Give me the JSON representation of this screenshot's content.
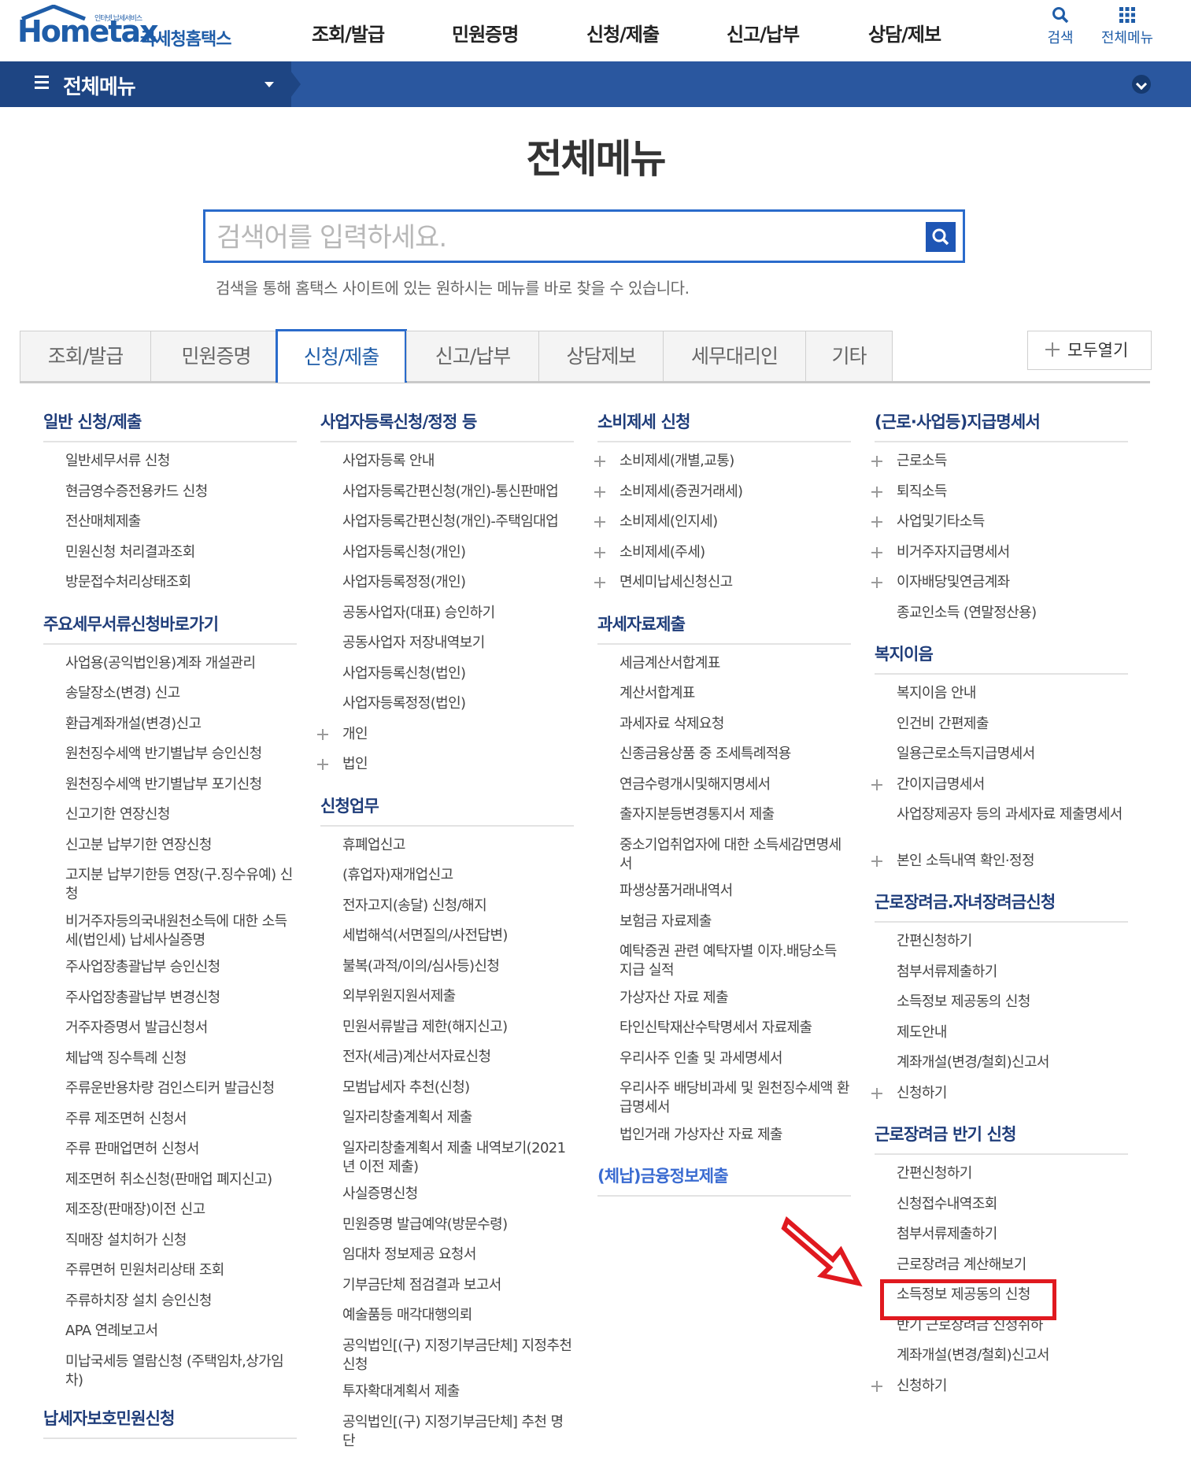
{
  "header": {
    "logo_small": "인터넷 납세서비스",
    "logo_main": "Hometax",
    "logo_sub": "국세청홈택스",
    "nav": [
      "조회/발급",
      "민원증명",
      "신청/제출",
      "신고/납부",
      "상담/제보"
    ],
    "search_label": "검색",
    "menu_label": "전체메뉴"
  },
  "bar": {
    "title": "전체메뉴"
  },
  "page": {
    "title": "전체메뉴",
    "search_placeholder": "검색어를 입력하세요.",
    "search_hint": "검색을 통해 홈택스 사이트에 있는 원하시는 메뉴를 바로 찾을 수 있습니다."
  },
  "tabs": [
    {
      "label": "조회/발급",
      "active": false
    },
    {
      "label": "민원증명",
      "active": false
    },
    {
      "label": "신청/제출",
      "active": true
    },
    {
      "label": "신고/납부",
      "active": false
    },
    {
      "label": "상담제보",
      "active": false
    },
    {
      "label": "세무대리인",
      "active": false
    },
    {
      "label": "기타",
      "active": false
    }
  ],
  "open_all_label": "모두열기",
  "columns": [
    {
      "sections": [
        {
          "title": "일반 신청/제출",
          "items": [
            {
              "text": "일반세무서류 신청"
            },
            {
              "text": "현금영수증전용카드 신청"
            },
            {
              "text": "전산매체제출"
            },
            {
              "text": "민원신청 처리결과조회"
            },
            {
              "text": "방문접수처리상태조회"
            }
          ]
        },
        {
          "title": "주요세무서류신청바로가기",
          "items": [
            {
              "text": "사업용(공익법인용)계좌 개설관리"
            },
            {
              "text": "송달장소(변경) 신고"
            },
            {
              "text": "환급계좌개설(변경)신고"
            },
            {
              "text": "원천징수세액 반기별납부 승인신청"
            },
            {
              "text": "원천징수세액 반기별납부 포기신청"
            },
            {
              "text": "신고기한 연장신청"
            },
            {
              "text": "신고분 납부기한 연장신청"
            },
            {
              "text": "고지분 납부기한등 연장(구.징수유예) 신청"
            },
            {
              "text": "비거주자등의국내원천소득에 대한 소득세(법인세) 납세사실증명"
            },
            {
              "text": "주사업장총괄납부 승인신청"
            },
            {
              "text": "주사업장총괄납부 변경신청"
            },
            {
              "text": "거주자증명서 발급신청서"
            },
            {
              "text": "체납액 징수특례 신청"
            },
            {
              "text": "주류운반용차량 검인스티커 발급신청"
            },
            {
              "text": "주류 제조면허 신청서"
            },
            {
              "text": "주류 판매업면허 신청서"
            },
            {
              "text": "제조면허 취소신청(판매업 폐지신고)"
            },
            {
              "text": "제조장(판매장)이전 신고"
            },
            {
              "text": "직매장 설치허가 신청"
            },
            {
              "text": "주류면허 민원처리상태 조회"
            },
            {
              "text": "주류하치장 설치 승인신청"
            },
            {
              "text": "APA 연례보고서"
            },
            {
              "text": "미납국세등 열람신청 (주택임차,상가임차)"
            }
          ]
        },
        {
          "title": "납세자보호민원신청",
          "items": []
        }
      ]
    },
    {
      "sections": [
        {
          "title": "사업자등록신청/정정 등",
          "items": [
            {
              "text": "사업자등록 안내"
            },
            {
              "text": "사업자등록간편신청(개인)-통신판매업"
            },
            {
              "text": "사업자등록간편신청(개인)-주택임대업"
            },
            {
              "text": "사업자등록신청(개인)"
            },
            {
              "text": "사업자등록정정(개인)"
            },
            {
              "text": "공동사업자(대표) 승인하기"
            },
            {
              "text": "공동사업자 저장내역보기"
            },
            {
              "text": "사업자등록신청(법인)"
            },
            {
              "text": "사업자등록정정(법인)"
            },
            {
              "text": "개인",
              "plus": true
            },
            {
              "text": "법인",
              "plus": true
            }
          ]
        },
        {
          "title": "신청업무",
          "items": [
            {
              "text": "휴폐업신고"
            },
            {
              "text": "(휴업자)재개업신고"
            },
            {
              "text": "전자고지(송달) 신청/해지"
            },
            {
              "text": "세법해석(서면질의/사전답변)"
            },
            {
              "text": "불복(과적/이의/심사등)신청"
            },
            {
              "text": "외부위원지원서제출"
            },
            {
              "text": "민원서류발급 제한(해지신고)"
            },
            {
              "text": "전자(세금)계산서자료신청"
            },
            {
              "text": "모범납세자 추천(신청)"
            },
            {
              "text": "일자리창출계획서 제출"
            },
            {
              "text": "일자리창출계획서 제출 내역보기(2021년 이전 제출)"
            },
            {
              "text": "사실증명신청"
            },
            {
              "text": "민원증명 발급예약(방문수령)"
            },
            {
              "text": "임대차 정보제공 요청서"
            },
            {
              "text": "기부금단체 점검결과 보고서"
            },
            {
              "text": "예술품등 매각대행의뢰"
            },
            {
              "text": "공익법인[(구) 지정기부금단체] 지정추천 신청"
            },
            {
              "text": "투자확대계획서 제출"
            },
            {
              "text": "공익법인[(구) 지정기부금단체] 추천 명단"
            }
          ]
        }
      ]
    },
    {
      "sections": [
        {
          "title": "소비제세 신청",
          "items": [
            {
              "text": "소비제세(개별,교통)",
              "plus": true
            },
            {
              "text": "소비제세(증권거래세)",
              "plus": true
            },
            {
              "text": "소비제세(인지세)",
              "plus": true
            },
            {
              "text": "소비제세(주세)",
              "plus": true
            },
            {
              "text": "면세미납세신청신고",
              "plus": true
            }
          ]
        },
        {
          "title": "과세자료제출",
          "items": [
            {
              "text": "세금계산서합계표"
            },
            {
              "text": "계산서합계표"
            },
            {
              "text": "과세자료 삭제요청"
            },
            {
              "text": "신종금융상품 중 조세특례적용"
            },
            {
              "text": "연금수령개시및해지명세서"
            },
            {
              "text": "출자지분등변경통지서 제출"
            },
            {
              "text": "중소기업취업자에 대한 소득세감면명세서"
            },
            {
              "text": "파생상품거래내역서"
            },
            {
              "text": "보험금 자료제출"
            },
            {
              "text": "예탁증권 관련 예탁자별 이자.배당소득 지급 실적"
            },
            {
              "text": "가상자산 자료 제출"
            },
            {
              "text": "타인신탁재산수탁명세서 자료제출"
            },
            {
              "text": "우리사주 인출 및 과세명세서"
            },
            {
              "text": "우리사주 배당비과세 및 원천징수세액 환급명세서"
            },
            {
              "text": "법인거래 가상자산 자료 제출"
            }
          ]
        },
        {
          "title": "(체납)금융정보제출",
          "items": [],
          "blue": true
        }
      ]
    },
    {
      "sections": [
        {
          "title": "(근로·사업등)지급명세서",
          "items": [
            {
              "text": "근로소득",
              "plus": true
            },
            {
              "text": "퇴직소득",
              "plus": true
            },
            {
              "text": "사업및기타소득",
              "plus": true
            },
            {
              "text": "비거주자지급명세서",
              "plus": true
            },
            {
              "text": "이자배당및연금계좌",
              "plus": true
            },
            {
              "text": "종교인소득 (연말정산용)"
            }
          ]
        },
        {
          "title": "복지이음",
          "items": [
            {
              "text": "복지이음 안내"
            },
            {
              "text": "인건비 간편제출"
            },
            {
              "text": "일용근로소득지급명세서"
            },
            {
              "text": "간이지급명세서",
              "plus": true
            },
            {
              "text": "사업장제공자 등의 과세자료 제출명세서"
            },
            {
              "text": "본인 소득내역 확인·정정",
              "plus": true
            }
          ]
        },
        {
          "title": "근로장려금.자녀장려금신청",
          "items": [
            {
              "text": "간편신청하기"
            },
            {
              "text": "첨부서류제출하기"
            },
            {
              "text": "소득정보 제공동의 신청"
            },
            {
              "text": "제도안내"
            },
            {
              "text": "계좌개설(변경/철회)신고서"
            },
            {
              "text": "신청하기",
              "plus": true
            }
          ]
        },
        {
          "title": "근로장려금 반기 신청",
          "items": [
            {
              "text": "간편신청하기"
            },
            {
              "text": "신청접수내역조회"
            },
            {
              "text": "첨부서류제출하기"
            },
            {
              "text": "근로장려금 계산해보기"
            },
            {
              "text": "소득정보 제공동의 신청"
            },
            {
              "text": "반기 근로장려금 신청취하"
            },
            {
              "text": "계좌개설(변경/철회)신고서"
            },
            {
              "text": "신청하기",
              "plus": true
            }
          ]
        }
      ]
    }
  ],
  "colors": {
    "brand": "#1f5da8",
    "bar": "#2a579f",
    "bar_dark": "#1e4583",
    "section_title": "#1f3d7a",
    "highlight": "#e0191f"
  },
  "highlighted_item": "근로장려금 계산해보기"
}
